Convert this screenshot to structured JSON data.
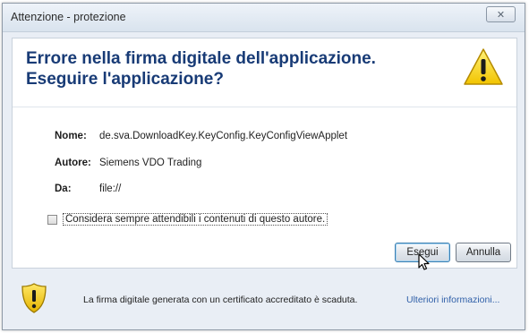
{
  "window": {
    "title": "Attenzione - protezione",
    "close_glyph": "✕"
  },
  "header": {
    "title": "Errore nella firma digitale dell'applicazione. Eseguire l'applicazione?",
    "icon": "warning-triangle-icon"
  },
  "details": {
    "name_label": "Nome:",
    "name_value": "de.sva.DownloadKey.KeyConfig.KeyConfigViewApplet",
    "author_label": "Autore:",
    "author_value": "Siemens VDO Trading",
    "from_label": "Da:",
    "from_value": "file://"
  },
  "checkbox": {
    "label": "Considera sempre attendibili i contenuti di questo autore.",
    "checked": false
  },
  "buttons": {
    "run": "Esegui",
    "cancel": "Annulla"
  },
  "footer": {
    "icon": "shield-warning-icon",
    "text": "La firma digitale generata con un certificato accreditato è scaduta.",
    "link": "Ulteriori informazioni..."
  },
  "colors": {
    "title_blue": "#183b76",
    "link_blue": "#2f5fa8",
    "warning_yellow": "#f5d000"
  }
}
